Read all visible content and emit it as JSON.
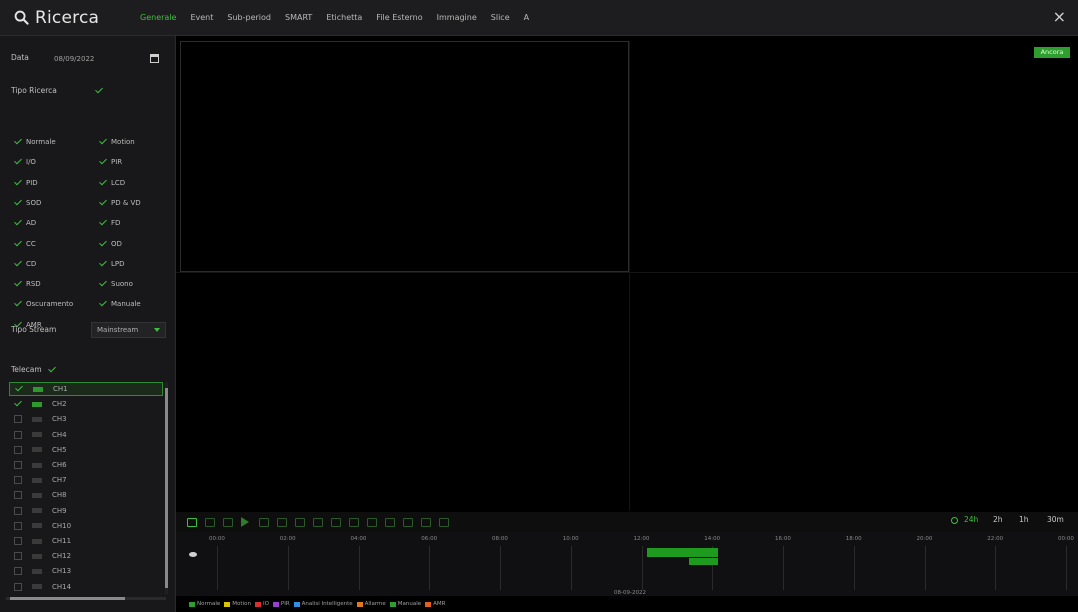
{
  "header": {
    "title": "Ricerca",
    "tabs": [
      {
        "label": "Generale",
        "active": true
      },
      {
        "label": "Event",
        "active": false
      },
      {
        "label": "Sub-period",
        "active": false
      },
      {
        "label": "SMART",
        "active": false
      },
      {
        "label": "Etichetta",
        "active": false
      },
      {
        "label": "File Esterno",
        "active": false
      },
      {
        "label": "Immagine",
        "active": false
      },
      {
        "label": "Slice",
        "active": false
      },
      {
        "label": "A",
        "active": false
      }
    ],
    "close_label": "×"
  },
  "sidebar": {
    "date_label": "Data",
    "date_value": "08/09/2022",
    "tipo_ricerca_label": "Tipo Ricerca",
    "tipo_ricerca_checked": true,
    "search_types": [
      {
        "label": "Normale",
        "checked": true
      },
      {
        "label": "Motion",
        "checked": true
      },
      {
        "label": "I/O",
        "checked": true
      },
      {
        "label": "PIR",
        "checked": true
      },
      {
        "label": "PID",
        "checked": true
      },
      {
        "label": "LCD",
        "checked": true
      },
      {
        "label": "SOD",
        "checked": true
      },
      {
        "label": "PD & VD",
        "checked": true
      },
      {
        "label": "AD",
        "checked": true
      },
      {
        "label": "FD",
        "checked": true
      },
      {
        "label": "CC",
        "checked": true
      },
      {
        "label": "OD",
        "checked": true
      },
      {
        "label": "CD",
        "checked": true
      },
      {
        "label": "LPD",
        "checked": true
      },
      {
        "label": "RSD",
        "checked": true
      },
      {
        "label": "Suono",
        "checked": true
      },
      {
        "label": "Oscuramento",
        "checked": true
      },
      {
        "label": "Manuale",
        "checked": true
      },
      {
        "label": "AMR",
        "checked": true
      }
    ],
    "stream_label": "Tipo Stream",
    "stream_value": "Mainstream",
    "cameras_label": "Telecam",
    "cameras_checked": true,
    "channels": [
      {
        "label": "CH1",
        "checked": true,
        "selected": true
      },
      {
        "label": "CH2",
        "checked": true,
        "selected": false
      },
      {
        "label": "CH3",
        "checked": false,
        "selected": false
      },
      {
        "label": "CH4",
        "checked": false,
        "selected": false
      },
      {
        "label": "CH5",
        "checked": false,
        "selected": false
      },
      {
        "label": "CH6",
        "checked": false,
        "selected": false
      },
      {
        "label": "CH7",
        "checked": false,
        "selected": false
      },
      {
        "label": "CH8",
        "checked": false,
        "selected": false
      },
      {
        "label": "CH9",
        "checked": false,
        "selected": false
      },
      {
        "label": "CH10",
        "checked": false,
        "selected": false
      },
      {
        "label": "CH11",
        "checked": false,
        "selected": false
      },
      {
        "label": "CH12",
        "checked": false,
        "selected": false
      },
      {
        "label": "CH13",
        "checked": false,
        "selected": false
      },
      {
        "label": "CH14",
        "checked": false,
        "selected": false
      }
    ]
  },
  "video": {
    "badge": "Ancora"
  },
  "toolbar": {
    "zoom_options": [
      {
        "label": "24h",
        "active": true
      },
      {
        "label": "2h",
        "active": false
      },
      {
        "label": "1h",
        "active": false
      },
      {
        "label": "30m",
        "active": false
      }
    ]
  },
  "timeline": {
    "hours": [
      "02:00",
      "04:00",
      "06:00",
      "08:00",
      "10:00",
      "12:00",
      "14:00",
      "16:00",
      "18:00",
      "20:00",
      "22:00",
      "00:00"
    ],
    "first_label": "00:00",
    "date": "08-09-2022",
    "records": [
      {
        "channel": "CH1",
        "start": "12:10",
        "end": "14:10"
      },
      {
        "channel": "CH2",
        "start": "13:20",
        "end": "14:10"
      }
    ]
  },
  "legend": [
    {
      "label": "Normale",
      "color": "#2e9f2e"
    },
    {
      "label": "Motion",
      "color": "#d8c400"
    },
    {
      "label": "IO",
      "color": "#d83030"
    },
    {
      "label": "PIR",
      "color": "#9b3fd0"
    },
    {
      "label": "Analisi Intelligente",
      "color": "#2f8fe0"
    },
    {
      "label": "Allarme",
      "color": "#e07a20"
    },
    {
      "label": "Manuale",
      "color": "#2e9f2e"
    },
    {
      "label": "AMR",
      "color": "#e06020"
    }
  ],
  "colors": {
    "accent": "#3fbf3f",
    "background": "#000000",
    "panel": "#18181a"
  }
}
